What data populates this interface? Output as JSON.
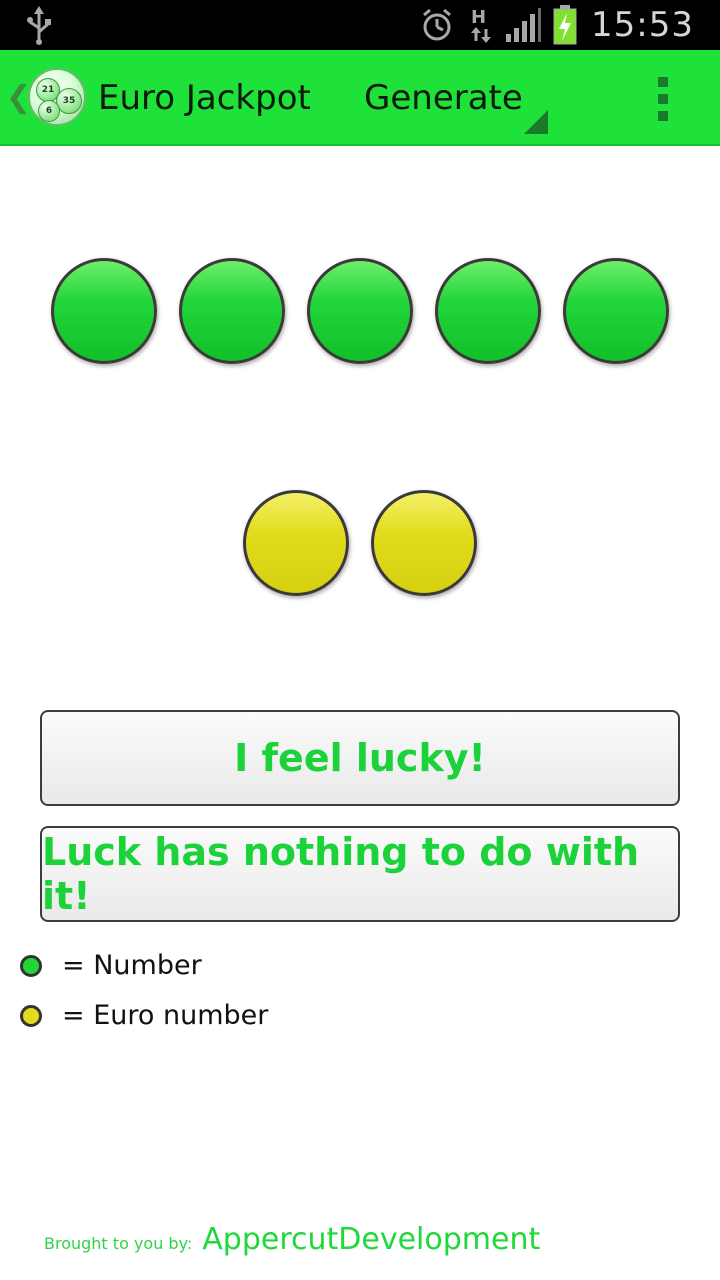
{
  "status_bar": {
    "time": "15:53",
    "network_type": "H",
    "icons": [
      "usb-icon",
      "alarm-icon",
      "data-transfer-icon",
      "signal-icon",
      "battery-charging-icon"
    ]
  },
  "action_bar": {
    "title": "Euro Jackpot",
    "logo_numbers": [
      "21",
      "35",
      "6"
    ],
    "nav_spinner_label": "Generate",
    "icons": [
      "up-chevron-icon",
      "app-logo-icon",
      "overflow-menu-icon"
    ],
    "color": "#1ee23a"
  },
  "balls": {
    "number_balls": [
      "",
      "",
      "",
      "",
      ""
    ],
    "euro_balls": [
      "",
      ""
    ],
    "number_color": "#22d63a",
    "euro_color": "#e2dc1e"
  },
  "buttons": {
    "lucky": "I feel lucky!",
    "luck_nothing": "Luck has nothing to do with it!"
  },
  "legend": {
    "number_label": "= Number",
    "euro_label": "= Euro number"
  },
  "footer": {
    "prefix": "Brought to you by:",
    "developer": "AppercutDevelopment"
  }
}
